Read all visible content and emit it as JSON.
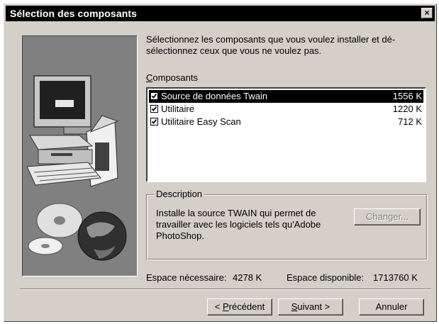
{
  "window": {
    "title": "Sélection des composants",
    "close_glyph": "×"
  },
  "instructions": "Sélectionnez les composants que vous voulez installer et dé-sélectionnez ceux que vous ne voulez pas.",
  "components": {
    "label_underlined": "C",
    "label_rest": "omposants",
    "items": [
      {
        "name": "Source de données  Twain",
        "size": "1556 K",
        "checked": true,
        "selected": true
      },
      {
        "name": "Utilitaire",
        "size": "1220 K",
        "checked": true,
        "selected": false
      },
      {
        "name": "Utilitaire Easy Scan",
        "size": "712 K",
        "checked": true,
        "selected": false
      }
    ]
  },
  "description": {
    "legend": "Description",
    "text": "Installe la source TWAIN qui permet de travailler avec les logiciels tels qu'Adobe PhotoShop.",
    "change_button": "Changer..."
  },
  "space": {
    "required_label": "Espace nécessaire:",
    "required_value": "4278 K",
    "available_label": "Espace disponible:",
    "available_value": "1713760 K"
  },
  "buttons": {
    "back_prefix": "< ",
    "back_underlined": "P",
    "back_rest": "récédent",
    "next_underlined": "S",
    "next_rest": "uivant >",
    "cancel": "Annuler"
  },
  "icons": {
    "close": "close-icon",
    "check": "checkmark-icon",
    "illustration": "computer-with-cds-illustration"
  },
  "colors": {
    "face": "#d4d0c8",
    "title_bar": "#000000",
    "selection": "#000000",
    "illustration_bg": "#808080"
  }
}
